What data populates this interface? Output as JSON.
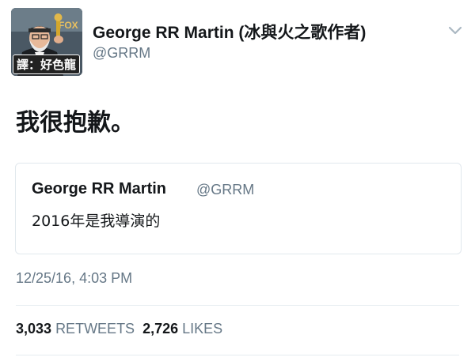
{
  "author": {
    "display_name": "George RR Martin (冰與火之歌作者)",
    "handle": "@GRRM",
    "avatar_credit": "譯：好色龍",
    "avatar_watermark": "FOX"
  },
  "tweet": {
    "text": "我很抱歉。"
  },
  "quoted_tweet": {
    "display_name": "George RR Martin",
    "handle": "@GRRM",
    "text": "2016年是我導演的"
  },
  "timestamp": "12/25/16, 4:03 PM",
  "stats": {
    "retweets_count": "3,033",
    "retweets_label": "RETWEETS",
    "likes_count": "2,726",
    "likes_label": "LIKES"
  },
  "icons": {
    "menu": "chevron-down-icon"
  },
  "colors": {
    "text_primary": "#14171a",
    "text_secondary": "#657786",
    "border": "#e1e8ed"
  }
}
